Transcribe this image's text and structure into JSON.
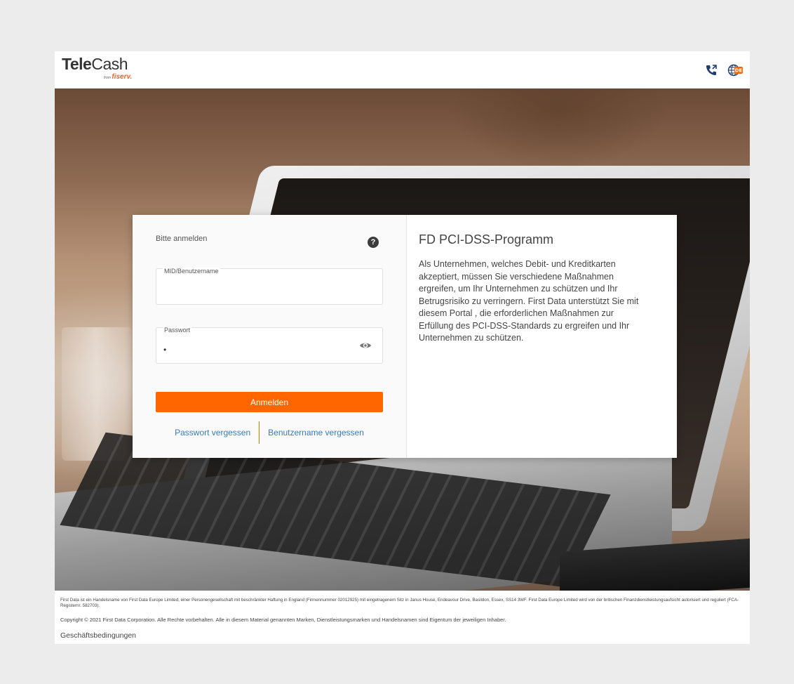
{
  "header": {
    "logo_bold": "Tele",
    "logo_regular": "Cash",
    "logo_from": "from",
    "logo_brand": "fiserv."
  },
  "login": {
    "title": "Bitte anmelden",
    "help_symbol": "?",
    "username_label": "MID/Benutzername",
    "username_value": "",
    "password_label": "Passwort",
    "password_value": "•",
    "submit_label": "Anmelden",
    "forgot_password": "Passwort vergessen",
    "forgot_username": "Benutzername vergessen"
  },
  "promo": {
    "title": "FD PCI-DSS-Programm",
    "text": "Als Unternehmen, welches Debit- und Kreditkarten akzeptiert, müssen Sie verschiedene Maßnahmen ergreifen, um Ihr Unternehmen zu schützen und Ihr Betrugsrisiko zu verringern. First Data unterstützt Sie mit diesem Portal , die erforderlichen Maßnahmen zur Erfüllung des PCI-DSS-Standards zu ergreifen und Ihr Unternehmen zu schützen."
  },
  "footer": {
    "legal": "First Data ist ein Handelsname von First Data Europe Limited, einer Personengesellschaft mit beschränkter Haftung in England (Firmennummer 02012925) mit eingetragenem Sitz in Janus House, Endeavour Drive, Basildon, Essex, SS14 3WF. First Data Europe Limited wird von der britischen Finanzdienstleistungsaufsicht autorisiert und reguliert (FCA-Registernr. 582703).",
    "copyright": "Copyright © 2021 First Data Corporation. Alle Rechte vorbehalten. Alle in diesem Material genannten Marken, Dienstleistungsmarken und Handelsnamen sind Eigentum der jeweiligen Inhaber.",
    "terms": "Geschäftsbedingungen"
  },
  "language": {
    "code": "DE"
  },
  "colors": {
    "accent": "#ff6600",
    "link": "#3a7ab8",
    "background": "#ececec"
  },
  "icons": [
    "phone-icon",
    "language-globe-icon",
    "help-icon",
    "eye-icon"
  ]
}
